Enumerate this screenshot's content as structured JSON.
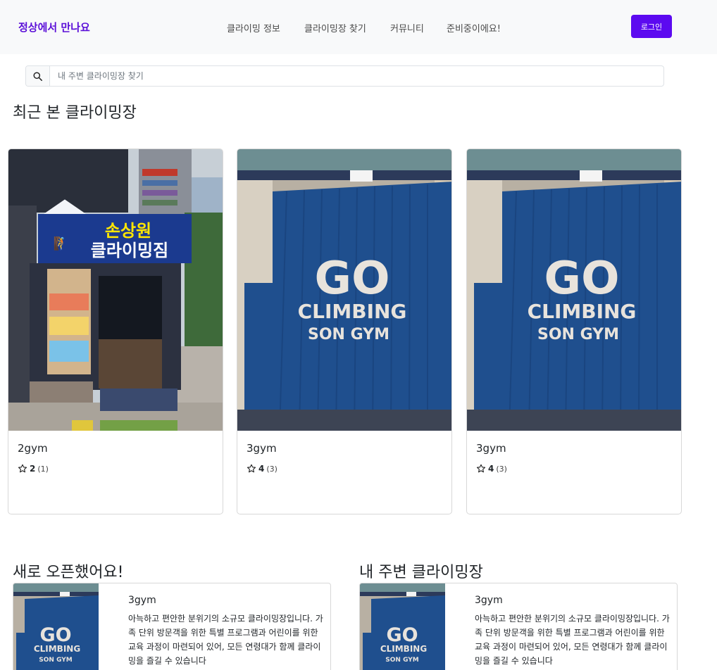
{
  "navbar": {
    "brand": "정상에서 만나요",
    "links": [
      "클라이밍 정보",
      "클라이밍장 찾기",
      "커뮤니티",
      "준비중이에요!"
    ],
    "login_label": "로그인"
  },
  "search": {
    "placeholder": "내 주변 클라이밍장 찾기",
    "icon": "search-icon"
  },
  "recent": {
    "title": "최근 본 클라이밍장",
    "cards": [
      {
        "name": "2gym",
        "score": "2",
        "count": "(1)",
        "sign_line1": "손상원",
        "sign_line2": "클라이밍짐"
      },
      {
        "name": "3gym",
        "score": "4",
        "count": "(3)",
        "wall_line1": "GO",
        "wall_line2": "CLIMBING",
        "wall_line3": "SON GYM"
      },
      {
        "name": "3gym",
        "score": "4",
        "count": "(3)",
        "wall_line1": "GO",
        "wall_line2": "CLIMBING",
        "wall_line3": "SON GYM"
      }
    ]
  },
  "new_open": {
    "title": "새로 오픈했어요!",
    "card": {
      "name": "3gym",
      "desc": "아늑하고 편안한 분위기의 소규모 클라이밍장입니다. 가족 단위 방문객을 위한 특별 프로그램과 어린이를 위한 교육 과정이 마련되어 있어, 모든 연령대가 함께 클라이밍을 즐길 수 있습니다",
      "wall_line1": "GO",
      "wall_line2": "CLIMBING",
      "wall_line3": "SON GYM"
    }
  },
  "nearby": {
    "title": "내 주변 클라이밍장",
    "card": {
      "name": "3gym",
      "desc": "아늑하고 편안한 분위기의 소규모 클라이밍장입니다. 가족 단위 방문객을 위한 특별 프로그램과 어린이를 위한 교육 과정이 마련되어 있어, 모든 연령대가 함께 클라이밍을 즐길 수 있습니다",
      "wall_line1": "GO",
      "wall_line2": "CLIMBING",
      "wall_line3": "SON GYM"
    }
  },
  "colors": {
    "brand": "#5b0fd8",
    "login_button": "#5c0af0",
    "navbar_bg": "#f8f9fa",
    "wall_blue": "#1f4f8e"
  }
}
